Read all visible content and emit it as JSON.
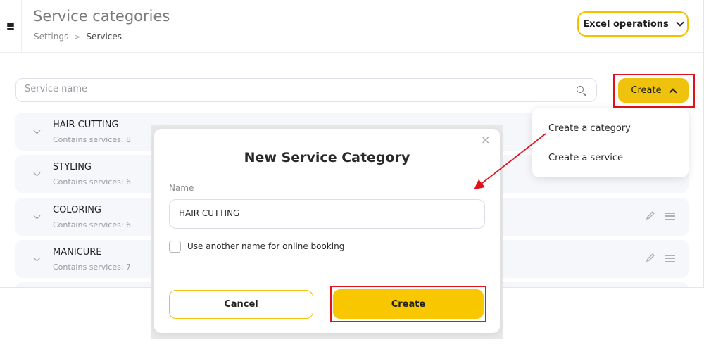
{
  "header": {
    "title": "Service categories",
    "breadcrumb": [
      "Settings",
      ">",
      "Services"
    ],
    "excel_label": "Excel operations"
  },
  "toolbar": {
    "search_placeholder": "Service name",
    "create_label": "Create"
  },
  "dropdown": {
    "items": [
      "Create a category",
      "Create a service"
    ]
  },
  "categories": [
    {
      "name": "HAIR CUTTING",
      "count": "Contains services: 8"
    },
    {
      "name": "STYLING",
      "count": "Contains services: 6"
    },
    {
      "name": "COLORING",
      "count": "Contains services: 6"
    },
    {
      "name": "MANICURE",
      "count": "Contains services: 7"
    }
  ],
  "modal": {
    "close": "×",
    "title": "New Service Category",
    "name_label": "Name",
    "name_value": "HAIR CUTTING",
    "checkbox_label": "Use another name for online booking",
    "cancel_label": "Cancel",
    "create_label": "Create"
  },
  "colors": {
    "accent": "#f9c700",
    "highlight": "#e2121c"
  }
}
